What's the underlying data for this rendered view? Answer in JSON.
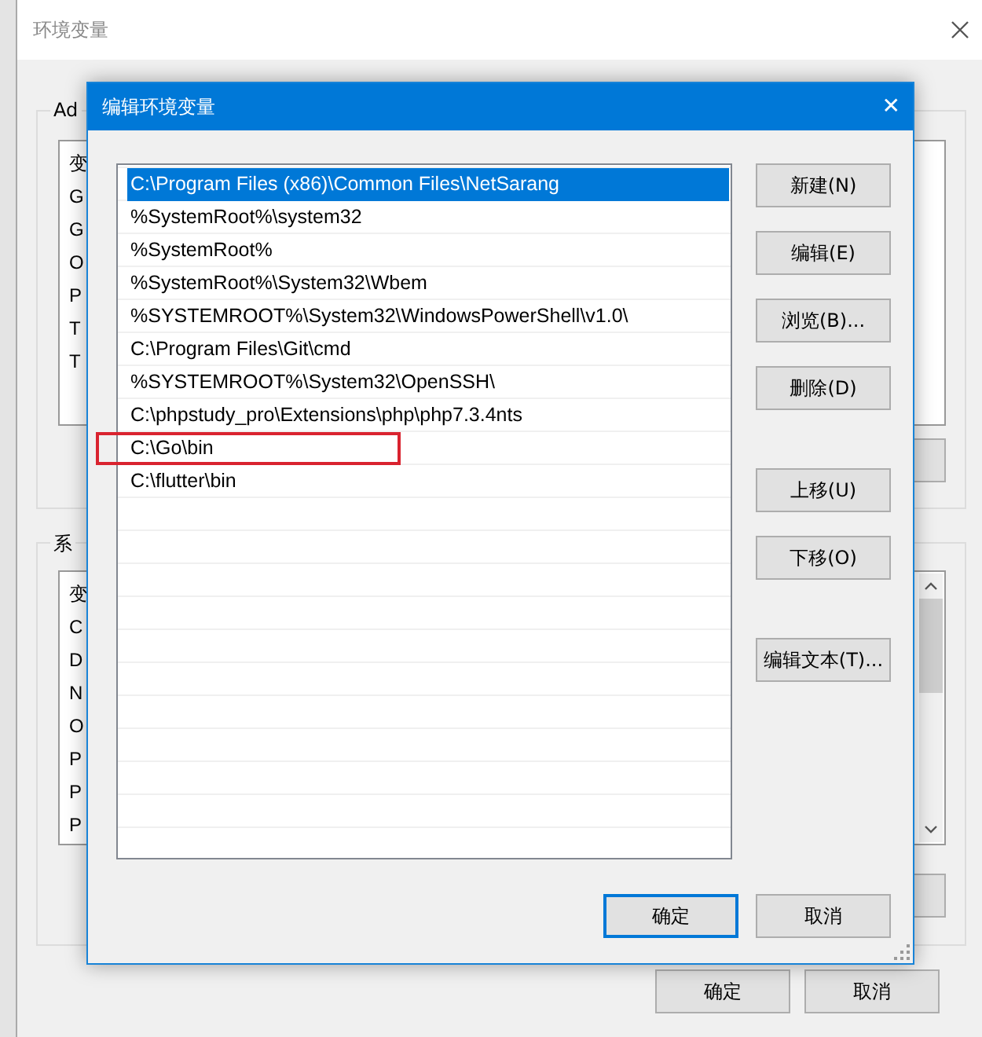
{
  "background_window": {
    "title": "环境变量",
    "user_group": {
      "label": "Ad",
      "items": [
        "变",
        "G",
        "G",
        "O",
        "P",
        "T",
        "T"
      ]
    },
    "system_group": {
      "label": "系",
      "items": [
        "变",
        "C",
        "D",
        "N",
        "O",
        "P",
        "P",
        "P"
      ]
    },
    "buttons": [
      "确定",
      "取消"
    ]
  },
  "dialog": {
    "title": "编辑环境变量",
    "close": "✕",
    "entries": [
      {
        "text": "C:\\Program Files (x86)\\Common Files\\NetSarang",
        "selected": true,
        "highlighted": false
      },
      {
        "text": "%SystemRoot%\\system32",
        "selected": false,
        "highlighted": false
      },
      {
        "text": "%SystemRoot%",
        "selected": false,
        "highlighted": false
      },
      {
        "text": "%SystemRoot%\\System32\\Wbem",
        "selected": false,
        "highlighted": false
      },
      {
        "text": "%SYSTEMROOT%\\System32\\WindowsPowerShell\\v1.0\\",
        "selected": false,
        "highlighted": false
      },
      {
        "text": "C:\\Program Files\\Git\\cmd",
        "selected": false,
        "highlighted": false
      },
      {
        "text": "%SYSTEMROOT%\\System32\\OpenSSH\\",
        "selected": false,
        "highlighted": false
      },
      {
        "text": "C:\\phpstudy_pro\\Extensions\\php\\php7.3.4nts",
        "selected": false,
        "highlighted": false
      },
      {
        "text": "C:\\Go\\bin",
        "selected": false,
        "highlighted": true
      },
      {
        "text": "C:\\flutter\\bin",
        "selected": false,
        "highlighted": false
      }
    ],
    "side_button_groups": [
      {
        "buttons": [
          "新建(N)",
          "编辑(E)",
          "浏览(B)...",
          "删除(D)"
        ]
      },
      {
        "buttons": [
          "上移(U)",
          "下移(O)"
        ]
      },
      {
        "buttons": [
          "编辑文本(T)..."
        ]
      }
    ],
    "ok": "确定",
    "cancel": "取消"
  }
}
